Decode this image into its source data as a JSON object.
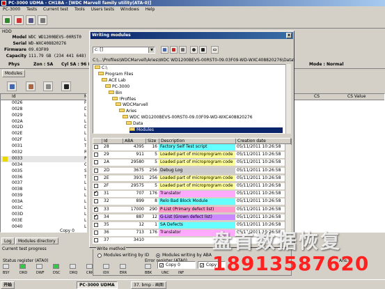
{
  "app": {
    "title": "PC-3000 UDMA - CH1BA - [WDC Marvell family utility(ATA-0)]",
    "menu": [
      "PC-3000",
      "Tests",
      "Current test",
      "Tools",
      "Users tests",
      "Windows",
      "Help"
    ]
  },
  "hdd": {
    "section_label": "HDD",
    "model_label": "Model",
    "model": "WDC WD1200BEVS-00RST0",
    "serial_label": "Serial",
    "serial": "WD-WXC408820276",
    "firmware_label": "Firmware",
    "firmware": "09.03F09",
    "capacity_label": "Capacity",
    "capacity": "111.79 GB (234 441 648)",
    "phys_label": "Phys",
    "zone_label": "Zon : SA",
    "cyl_label": "Cyl SA : 96 (40",
    "mode_label": "Mode : Normal"
  },
  "modules_tab": "Modules",
  "left_grid": {
    "col_id": "Id",
    "col_name": "Na",
    "rows": [
      {
        "id": "0026",
        "nm": "Fo"
      },
      {
        "id": "0028",
        "nm": "De"
      },
      {
        "id": "0029",
        "nm": "Lo"
      },
      {
        "id": "002A",
        "nm": "Lo"
      },
      {
        "id": "002D",
        "nm": "De"
      },
      {
        "id": "002E",
        "nm": "Lo"
      },
      {
        "id": "002F",
        "nm": "Lo"
      },
      {
        "id": "0031",
        "nm": "Tr"
      },
      {
        "id": "0032",
        "nm": "Re"
      },
      {
        "id": "0033",
        "nm": "P-",
        "sel": true
      },
      {
        "id": "0034",
        "nm": "G-"
      },
      {
        "id": "0035",
        "nm": "SA"
      },
      {
        "id": "0036",
        "nm": "Tr"
      },
      {
        "id": "0037",
        "nm": "Lo"
      },
      {
        "id": "0038",
        "nm": "Lo"
      },
      {
        "id": "0039",
        "nm": "Lo"
      },
      {
        "id": "003A",
        "nm": "Lo"
      },
      {
        "id": "003C",
        "nm": "Lo"
      },
      {
        "id": "003D",
        "nm": "Lo"
      },
      {
        "id": "003E",
        "nm": "Lo"
      },
      {
        "id": "0040",
        "nm": "Lo"
      }
    ],
    "copy_status": "Copy 0"
  },
  "right_grid": {
    "col_cs": "CS",
    "col_csvalue": "CS Value"
  },
  "bottom_tabs": [
    "Log",
    "Modules directory"
  ],
  "current_test": "Current test progress",
  "status": {
    "status_register_label": "Status register (ATA0)",
    "error_register_label": "Error register (ATA0)",
    "leds": [
      "BSY",
      "DRD",
      "DWF",
      "DSC",
      "DRQ",
      "CRR",
      "IDX",
      "ERR"
    ],
    "err_leds": [
      "BBK",
      "UNC",
      "INF"
    ],
    "extra_label": "Ans..."
  },
  "dialog": {
    "title": "Writing modules",
    "close": "x",
    "drive": "c: []",
    "path": "C:\\...\\Profiles\\WDCMarvell\\Aries\\WDC WD1200BEVS-00RST0-09.03F09-WD-WXC408820276\\Data\\Modules",
    "tree": [
      {
        "name": "C:\\",
        "depth": 0
      },
      {
        "name": "Program Files",
        "depth": 1
      },
      {
        "name": "ACE Lab",
        "depth": 2
      },
      {
        "name": "PC-3000",
        "depth": 3
      },
      {
        "name": "Bin",
        "depth": 4
      },
      {
        "name": "!Profiles",
        "depth": 5
      },
      {
        "name": "WDCMarvell",
        "depth": 6
      },
      {
        "name": "Aries",
        "depth": 7
      },
      {
        "name": "WDC WD1200BEVS-00RST0-09.03F09-WD-WXC408820276",
        "depth": 8
      },
      {
        "name": "Data",
        "depth": 9
      },
      {
        "name": "Modules",
        "depth": 10,
        "sel": true
      }
    ],
    "cols": {
      "id": "Id",
      "aba": "ABA",
      "size": "Size",
      "desc": "Description",
      "date": "Creation date"
    },
    "modules": [
      {
        "id": "28",
        "aba": "4395",
        "size": "16",
        "desc": "Factory Self Test script",
        "date": "05/11/2011 10:26:58",
        "color": "#66ffff",
        "chk": false
      },
      {
        "id": "29",
        "aba": "911",
        "size": "5",
        "desc": "Loaded part of microprogram code",
        "date": "05/11/2011 10:26:58",
        "color": "#ffff99",
        "chk": false
      },
      {
        "id": "2A",
        "aba": "29580",
        "size": "5",
        "desc": "Loaded part of microprogram code",
        "date": "05/11/2011 10:26:58",
        "color": "#ffff99",
        "chk": false
      },
      {
        "id": "2D",
        "aba": "3675",
        "size": "256",
        "desc": "Debug Log",
        "date": "05/11/2011 10:26:58",
        "color": "#cccccc",
        "chk": false
      },
      {
        "id": "2E",
        "aba": "3931",
        "size": "256",
        "desc": "Loaded part of microprogram code",
        "date": "05/11/2011 10:26:58",
        "color": "#ffff99",
        "chk": false
      },
      {
        "id": "2F",
        "aba": "29575",
        "size": "5",
        "desc": "Loaded part of microprogram code",
        "date": "05/11/2011 10:26:58",
        "color": "#ffff99",
        "chk": false
      },
      {
        "id": "31",
        "aba": "707",
        "size": "176",
        "desc": "Translator",
        "date": "05/11/2011 10:26:58",
        "color": "#ffaaff",
        "chk": true
      },
      {
        "id": "32",
        "aba": "899",
        "size": "8",
        "desc": "Relo Bad Block Module",
        "date": "05/11/2011 10:26:58",
        "color": "#66ffff",
        "chk": false
      },
      {
        "id": "33",
        "aba": "17000",
        "size": "290",
        "desc": "P-List (Primary defect list)",
        "date": "05/11/2011 10:26:58",
        "color": "#ff99cc",
        "chk": true
      },
      {
        "id": "34",
        "aba": "887",
        "size": "12",
        "desc": "G-List (Grown defect list)",
        "date": "05/11/2011 10:26:58",
        "color": "#cc88ff",
        "chk": true
      },
      {
        "id": "35",
        "aba": "12",
        "size": "1",
        "desc": "SA Defects",
        "date": "05/11/2011 10:26:58",
        "color": "#66ffff",
        "chk": false
      },
      {
        "id": "36",
        "aba": "713",
        "size": "176",
        "desc": "Translator",
        "date": "05/11/2011 10:26:58",
        "color": "#ffaaff",
        "chk": false
      },
      {
        "id": "37",
        "aba": "3410",
        "size": "",
        "desc": "",
        "date": "",
        "color": "#ffffff",
        "chk": false
      }
    ],
    "write_method_label": "Write method",
    "radio_id": "Modules writing by ID",
    "radio_aba": "Modules writing by ABA",
    "copy0": "Copy 0",
    "copy1": "Copy 1"
  },
  "taskbar": {
    "start": "开始",
    "task1": "PC-3000 UDMA",
    "task2": "37. bmp - 画图"
  },
  "watermark": {
    "line1": "盘首数据恢复",
    "line2": "18913587620"
  }
}
